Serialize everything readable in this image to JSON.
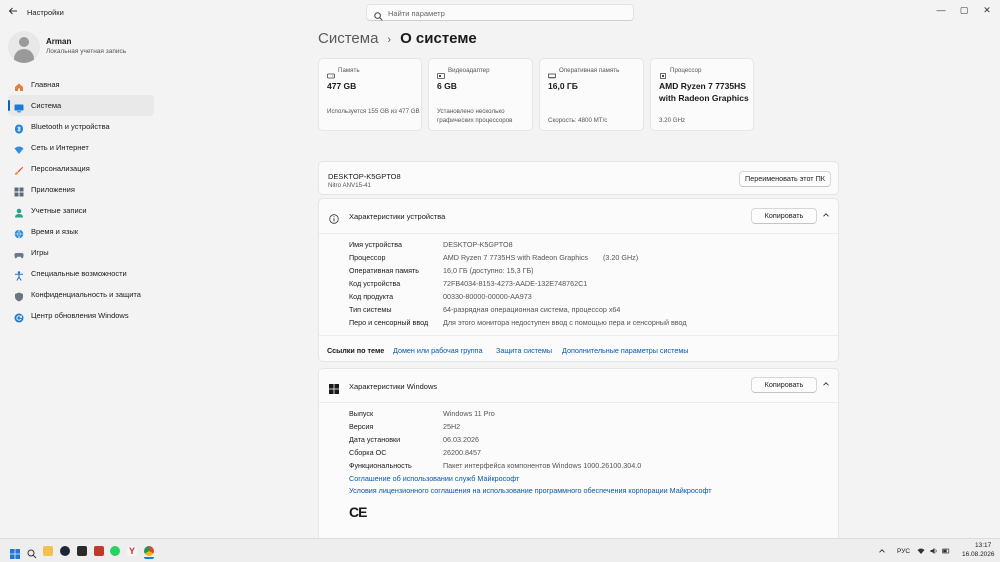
{
  "window": {
    "title": "Настройки",
    "search_placeholder": "Найти параметр",
    "minimize": "—",
    "maximize": "▢",
    "close": "✕"
  },
  "user": {
    "name": "Arman",
    "account_type": "Локальная учетная запись"
  },
  "sidebar": {
    "items": [
      {
        "label": "Главная",
        "icon": "home-icon"
      },
      {
        "label": "Система",
        "icon": "system-icon",
        "active": true
      },
      {
        "label": "Bluetooth и устройства",
        "icon": "bluetooth-icon"
      },
      {
        "label": "Сеть и Интернет",
        "icon": "network-icon"
      },
      {
        "label": "Персонализация",
        "icon": "brush-icon"
      },
      {
        "label": "Приложения",
        "icon": "apps-icon"
      },
      {
        "label": "Учетные записи",
        "icon": "accounts-icon"
      },
      {
        "label": "Время и язык",
        "icon": "globe-icon"
      },
      {
        "label": "Игры",
        "icon": "gamepad-icon"
      },
      {
        "label": "Специальные возможности",
        "icon": "accessibility-icon"
      },
      {
        "label": "Конфиденциальность и защита",
        "icon": "shield-icon"
      },
      {
        "label": "Центр обновления Windows",
        "icon": "update-icon"
      }
    ]
  },
  "breadcrumb": {
    "parent": "Система",
    "separator": "›",
    "current": "О системе"
  },
  "cards": [
    {
      "label": "Память",
      "value": "477 GB",
      "sub": "Используется 155 GB из 477 GB",
      "icon": "storage-icon"
    },
    {
      "label": "Видеоадаптер",
      "value": "6 GB",
      "sub": "Установлено несколько графических процессоров",
      "icon": "gpu-icon"
    },
    {
      "label": "Оперативная память",
      "value": "16,0 ГБ",
      "sub": "Скорость: 4800 МТ/с",
      "icon": "ram-icon"
    },
    {
      "label": "Процессор",
      "value": "AMD Ryzen 7 7735HS with Radeon Graphics",
      "sub": "3.20 GHz",
      "icon": "cpu-icon"
    }
  ],
  "pc": {
    "name": "DESKTOP-K5GPTO8",
    "model": "Nitro ANV15-41",
    "rename_button": "Переименовать этот ПК"
  },
  "device_specs": {
    "title": "Характеристики устройства",
    "copy_button": "Копировать",
    "rows": [
      {
        "key": "Имя устройства",
        "value": "DESKTOP-K5GPTO8",
        "extra": ""
      },
      {
        "key": "Процессор",
        "value": "AMD Ryzen 7 7735HS with Radeon Graphics",
        "extra": "(3.20 GHz)"
      },
      {
        "key": "Оперативная память",
        "value": "16,0 ГБ (доступно: 15,3 ГБ)",
        "extra": ""
      },
      {
        "key": "Код устройства",
        "value": "72FB4034-8153-4273-AADE-132E748762C1",
        "extra": ""
      },
      {
        "key": "Код продукта",
        "value": "00330-80000-00000-AA973",
        "extra": ""
      },
      {
        "key": "Тип системы",
        "value": "64-разрядная операционная система, процессор x64",
        "extra": ""
      },
      {
        "key": "Перо и сенсорный ввод",
        "value": "Для этого монитора недоступен ввод с помощью пера и сенсорный ввод",
        "extra": ""
      }
    ]
  },
  "related_links": {
    "label": "Ссылки по теме",
    "links": [
      "Домен или рабочая группа",
      "Защита системы",
      "Дополнительные параметры системы"
    ]
  },
  "windows_specs": {
    "title": "Характеристики Windows",
    "copy_button": "Копировать",
    "rows": [
      {
        "key": "Выпуск",
        "value": "Windows 11 Pro"
      },
      {
        "key": "Версия",
        "value": "25H2"
      },
      {
        "key": "Дата установки",
        "value": "06.03.2026"
      },
      {
        "key": "Сборка ОС",
        "value": "26200.8457"
      },
      {
        "key": "Функциональность",
        "value": "Пакет интерфейса компонентов Windows 1000.26100.304.0"
      }
    ],
    "links": [
      "Соглашение об использовании служб Майкрософт",
      "Условия лицензионного соглашения на использование программного обеспечения корпорации Майкрософт"
    ],
    "ce_mark": "CE"
  },
  "taskbar": {
    "language": "РУС",
    "time": "13:17",
    "date": "16.08.2026",
    "pinned": [
      "windows-start-icon",
      "search-icon",
      "file-explorer-icon",
      "steam-icon",
      "epic-games-icon",
      "app-icon",
      "whatsapp-icon",
      "yandex-browser-icon",
      "chrome-icon",
      "settings-icon"
    ]
  }
}
